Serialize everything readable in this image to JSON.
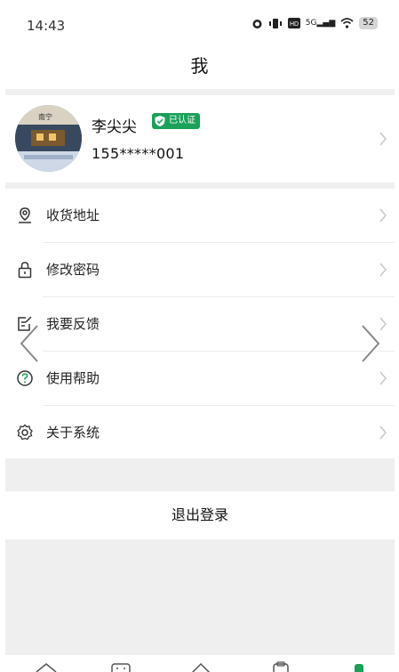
{
  "status_bar": {
    "time": "14:43",
    "network": "5G",
    "battery": "52",
    "icons": [
      "alarm-icon",
      "vibrate-icon",
      "hd-icon",
      "signal-icon",
      "wifi-icon",
      "battery-icon"
    ]
  },
  "header": {
    "title": "我"
  },
  "profile": {
    "name": "李尖尖",
    "badge": "已认证",
    "phone": "155*****001",
    "avatar_sign": "南宁"
  },
  "menu": {
    "items": [
      {
        "label": "收货地址",
        "icon": "location-pin-icon"
      },
      {
        "label": "修改密码",
        "icon": "lock-icon"
      },
      {
        "label": "我要反馈",
        "icon": "edit-feedback-icon"
      },
      {
        "label": "使用帮助",
        "icon": "help-circle-icon"
      },
      {
        "label": "关于系统",
        "icon": "settings-gear-icon"
      }
    ]
  },
  "logout": {
    "label": "退出登录"
  },
  "tabbar": {
    "icons": [
      "home-icon",
      "category-icon",
      "discover-icon",
      "orders-icon",
      "profile-icon"
    ]
  },
  "colors": {
    "accent": "#1aa15a",
    "divider": "#f0f0f0",
    "band": "#efefef",
    "text": "#222222",
    "chevron": "#c8c8c8"
  }
}
